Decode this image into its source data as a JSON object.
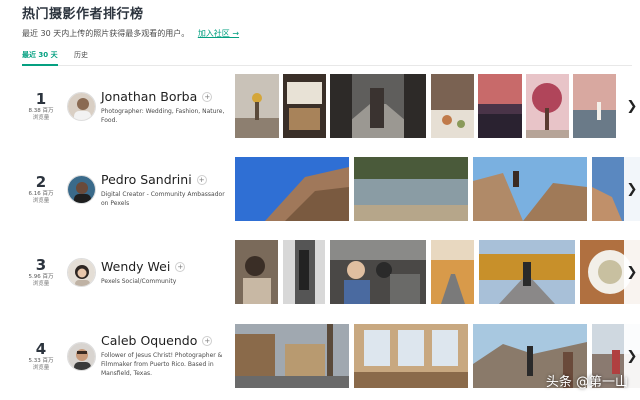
{
  "page": {
    "title": "热门摄影作者排行榜",
    "subtitle": "最近 30 天内上传的照片获得最多观看的用户。",
    "join_link": "加入社区 →"
  },
  "tabs": [
    {
      "label": "最近 30 天",
      "active": true
    },
    {
      "label": "历史",
      "active": false
    }
  ],
  "authors": [
    {
      "rank": "1",
      "views": "8.38 百万",
      "views_label": "浏览量",
      "name": "Jonathan Borba",
      "follow_symbol": "+",
      "bio": "Photographer: Wedding, Fashion, Nature, Food."
    },
    {
      "rank": "2",
      "views": "6.16 百万",
      "views_label": "浏览量",
      "name": "Pedro Sandrini",
      "follow_symbol": "+",
      "bio": "Digital Creator - Community Ambassador on Pexels"
    },
    {
      "rank": "3",
      "views": "5.96 百万",
      "views_label": "浏览量",
      "name": "Wendy Wei",
      "follow_symbol": "+",
      "bio": "Pexels Social/Community"
    },
    {
      "rank": "4",
      "views": "5.33 百万",
      "views_label": "浏览量",
      "name": "Caleb Oquendo",
      "follow_symbol": "+",
      "bio": "Follower of Jesus Christ! Photographer & Filmmaker from Puerto Rico. Based in Mansfield, Texas."
    }
  ],
  "next_symbol": "❯",
  "watermark": "头条 @第一山",
  "colors": {
    "accent": "#05a081",
    "text": "#2c343e"
  }
}
